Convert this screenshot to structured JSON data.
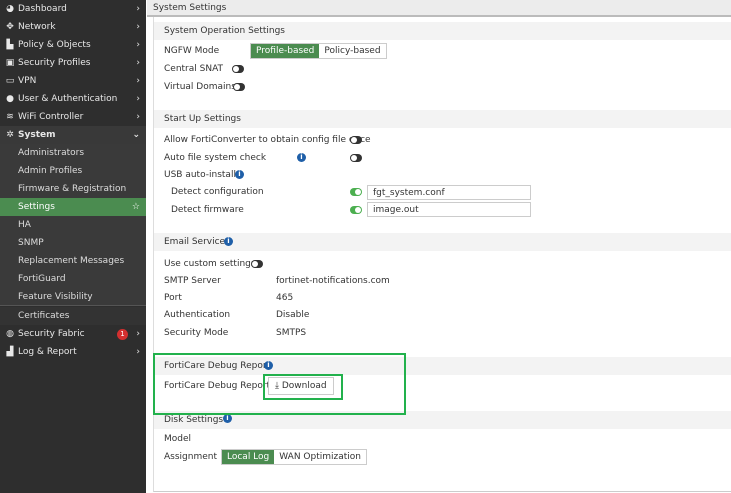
{
  "sidebar": {
    "items": [
      {
        "label": "Dashboard",
        "icon": "dashboard-icon"
      },
      {
        "label": "Network",
        "icon": "network-icon"
      },
      {
        "label": "Policy & Objects",
        "icon": "policy-icon"
      },
      {
        "label": "Security Profiles",
        "icon": "lock-icon"
      },
      {
        "label": "VPN",
        "icon": "laptop-icon"
      },
      {
        "label": "User & Authentication",
        "icon": "user-icon"
      },
      {
        "label": "WiFi Controller",
        "icon": "wifi-icon"
      },
      {
        "label": "System",
        "icon": "gear-icon"
      }
    ],
    "system_sub": [
      "Administrators",
      "Admin Profiles",
      "Firmware & Registration",
      "Settings",
      "HA",
      "SNMP",
      "Replacement Messages",
      "FortiGuard",
      "Feature Visibility",
      "Certificates"
    ],
    "security_fabric": {
      "label": "Security Fabric",
      "badge": "1"
    },
    "log_report": {
      "label": "Log & Report"
    }
  },
  "header": {
    "title": "System Settings"
  },
  "sysop": {
    "title": "System Operation Settings",
    "ngfw_label": "NGFW Mode",
    "ngfw_options": [
      "Profile-based",
      "Policy-based"
    ],
    "central_snat": "Central SNAT",
    "vdoms": "Virtual Domains"
  },
  "startup": {
    "title": "Start Up Settings",
    "forticonverter": "Allow FortiConverter to obtain config file once",
    "auto_fs": "Auto file system check",
    "usb": "USB auto-install",
    "detect_config": "Detect configuration",
    "detect_config_value": "fgt_system.conf",
    "detect_fw": "Detect firmware",
    "detect_fw_value": "image.out"
  },
  "email": {
    "title": "Email Service",
    "custom": "Use custom settings",
    "rows": [
      [
        "SMTP Server",
        "fortinet-notifications.com"
      ],
      [
        "Port",
        "465"
      ],
      [
        "Authentication",
        "Disable"
      ],
      [
        "Security Mode",
        "SMTPS"
      ]
    ]
  },
  "forticare": {
    "title": "FortiCare Debug Report",
    "label": "FortiCare Debug Report",
    "button": "Download"
  },
  "disk": {
    "title": "Disk Settings",
    "model": "Model",
    "assignment": "Assignment",
    "options": [
      "Local Log",
      "WAN Optimization"
    ]
  },
  "colors": {
    "accent": "#4b8c50",
    "highlight": "#22b14c"
  }
}
